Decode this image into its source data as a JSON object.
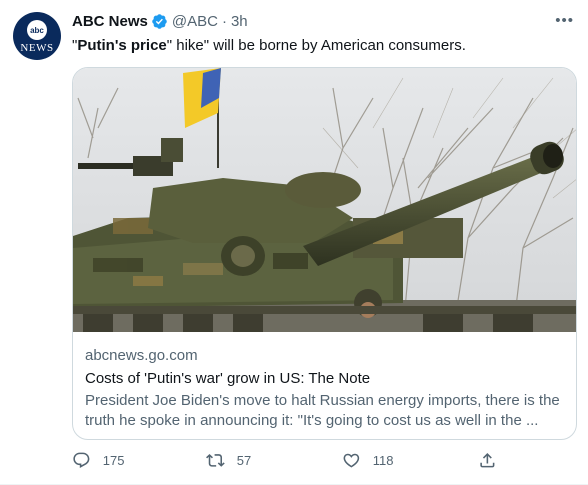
{
  "tweet": {
    "author_name": "ABC News",
    "handle": "@ABC",
    "separator": "·",
    "time": "3h",
    "more_label": "•••",
    "text_prefix_quote": "\"",
    "text_bold": "Putin's price",
    "text_rest": "\" hike\" will be borne by American consumers."
  },
  "avatar": {
    "logo_text": "abc",
    "news_text": "NEWS",
    "bg_color": "#0a2a5c"
  },
  "card": {
    "domain": "abcnews.go.com",
    "title": "Costs of 'Putin's war' grow in US: The Note",
    "description_line1": "President Joe Biden's move to halt Russian energy imports, there is the",
    "description_line2": "truth he spoke in announcing it: \"It's going to cost us as well in the ..."
  },
  "actions": {
    "reply_count": "175",
    "retweet_count": "57",
    "like_count": "118"
  },
  "icons": [
    "verified-badge-icon",
    "more-icon",
    "reply-icon",
    "retweet-icon",
    "like-icon",
    "share-icon"
  ],
  "colors": {
    "accent": "#1d9bf0",
    "secondary_text": "#536471",
    "border": "#cfd9de"
  }
}
